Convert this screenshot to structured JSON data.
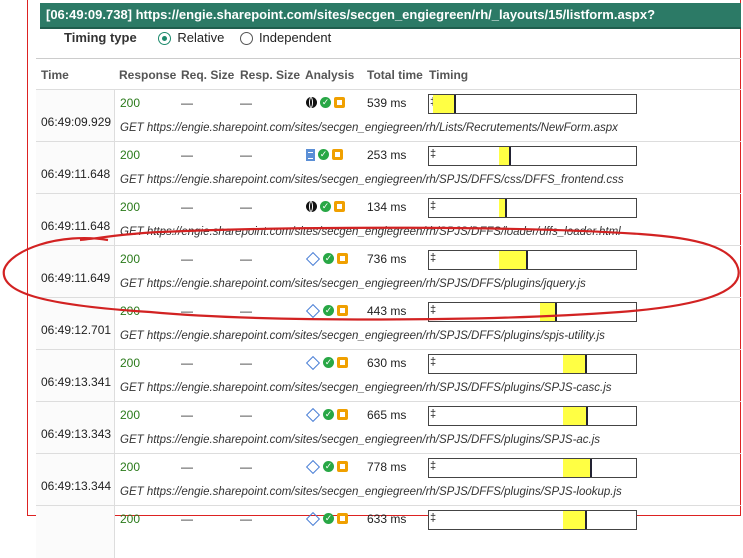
{
  "header": {
    "title": "[06:49:09.738] https://engie.sharepoint.com/sites/secgen_engiegreen/rh/_layouts/15/listform.aspx?"
  },
  "timing_type": {
    "label": "Timing type",
    "options": [
      {
        "label": "Relative",
        "selected": true
      },
      {
        "label": "Independent",
        "selected": false
      }
    ]
  },
  "columns": [
    "Time",
    "Response",
    "Req. Size",
    "Resp. Size",
    "Analysis",
    "Total time",
    "Timing"
  ],
  "requests": [
    {
      "time": "06:49:09.929",
      "response": "200",
      "req_size": "—",
      "resp_size": "—",
      "icon": "globe-icon",
      "total": "539 ms",
      "url": "GET https://engie.sharepoint.com/sites/secgen_engiegreen/rh/Lists/Recrutements/NewForm.aspx",
      "start": 0.02,
      "width": 0.1,
      "mark": 0.12
    },
    {
      "time": "06:49:11.648",
      "response": "200",
      "req_size": "—",
      "resp_size": "—",
      "icon": "document-icon",
      "total": "253 ms",
      "url": "GET https://engie.sharepoint.com/sites/secgen_engiegreen/rh/SPJS/DFFS/css/DFFS_frontend.css",
      "start": 0.34,
      "width": 0.045,
      "mark": 0.385
    },
    {
      "time": "06:49:11.648",
      "response": "200",
      "req_size": "—",
      "resp_size": "—",
      "icon": "globe-icon",
      "total": "134 ms",
      "url": "GET https://engie.sharepoint.com/sites/secgen_engiegreen/rh/SPJS/DFFS/loader/dffs_loader.html",
      "start": 0.34,
      "width": 0.025,
      "mark": 0.365
    },
    {
      "time": "06:49:11.649",
      "response": "200",
      "req_size": "—",
      "resp_size": "—",
      "icon": "diamond-icon",
      "total": "736 ms",
      "url": "GET https://engie.sharepoint.com/sites/secgen_engiegreen/rh/SPJS/DFFS/plugins/jquery.js",
      "start": 0.34,
      "width": 0.13,
      "mark": 0.47
    },
    {
      "time": "06:49:12.701",
      "response": "200",
      "req_size": "—",
      "resp_size": "—",
      "icon": "diamond-icon",
      "total": "443 ms",
      "url": "GET https://engie.sharepoint.com/sites/secgen_engiegreen/rh/SPJS/DFFS/plugins/spjs-utility.js",
      "start": 0.535,
      "width": 0.075,
      "mark": 0.61
    },
    {
      "time": "06:49:13.341",
      "response": "200",
      "req_size": "—",
      "resp_size": "—",
      "icon": "diamond-icon",
      "total": "630 ms",
      "url": "GET https://engie.sharepoint.com/sites/secgen_engiegreen/rh/SPJS/DFFS/plugins/SPJS-casc.js",
      "start": 0.645,
      "width": 0.11,
      "mark": 0.755
    },
    {
      "time": "06:49:13.343",
      "response": "200",
      "req_size": "—",
      "resp_size": "—",
      "icon": "diamond-icon",
      "total": "665 ms",
      "url": "GET https://engie.sharepoint.com/sites/secgen_engiegreen/rh/SPJS/DFFS/plugins/SPJS-ac.js",
      "start": 0.645,
      "width": 0.115,
      "mark": 0.76
    },
    {
      "time": "06:49:13.344",
      "response": "200",
      "req_size": "—",
      "resp_size": "—",
      "icon": "diamond-icon",
      "total": "778 ms",
      "url": "GET https://engie.sharepoint.com/sites/secgen_engiegreen/rh/SPJS/DFFS/plugins/SPJS-lookup.js",
      "start": 0.645,
      "width": 0.135,
      "mark": 0.78
    },
    {
      "time": "",
      "response": "200",
      "req_size": "—",
      "resp_size": "—",
      "icon": "diamond-icon",
      "total": "633 ms",
      "url": "",
      "start": 0.645,
      "width": 0.11,
      "mark": 0.755
    }
  ],
  "colors": {
    "titlebar": "#2c7a66",
    "bar_fill": "#ffff44",
    "annotation": "#d22222"
  }
}
